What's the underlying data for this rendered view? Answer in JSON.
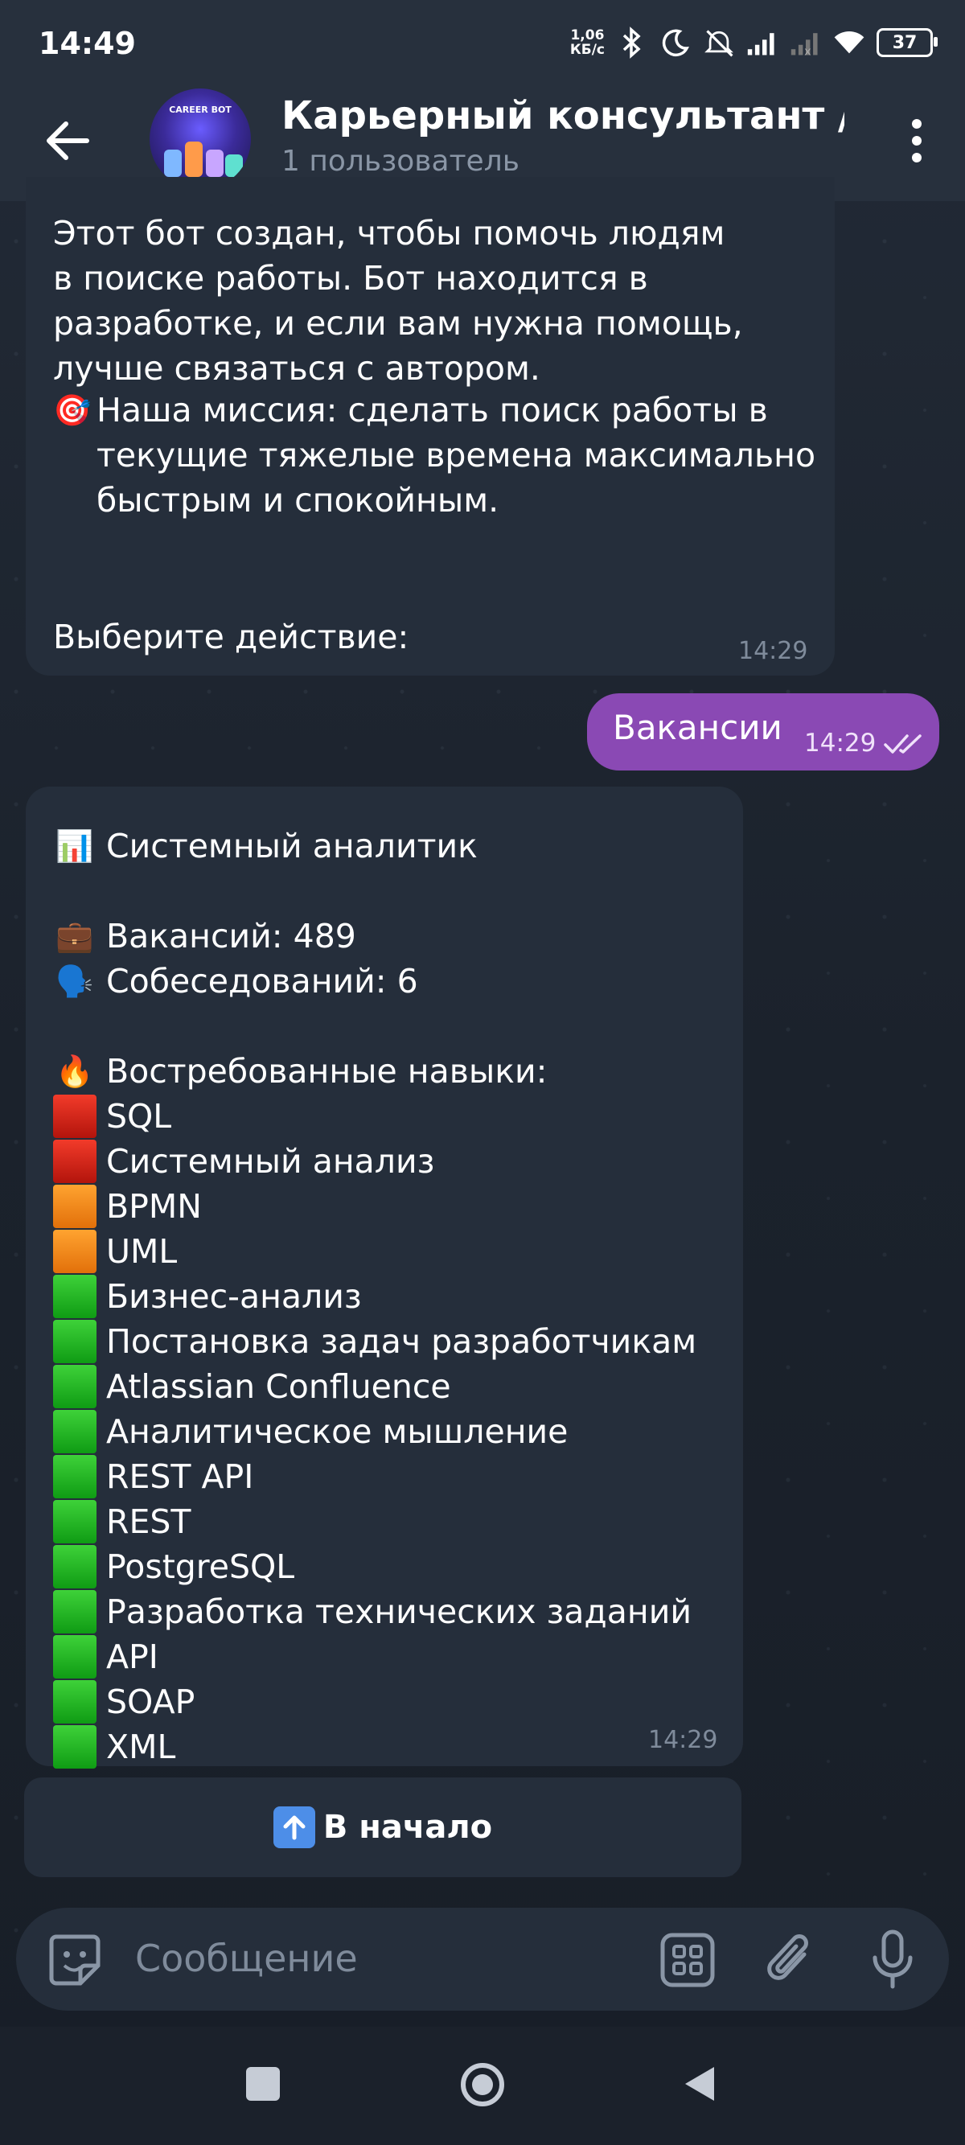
{
  "status_bar": {
    "time": "14:49",
    "net_speed_value": "1,06",
    "net_speed_unit": "КБ/с",
    "battery": "37",
    "icons": [
      "bluetooth-icon",
      "moon-icon",
      "mute-icon",
      "signal-icon",
      "signal-icon",
      "wifi-icon",
      "battery-icon"
    ]
  },
  "header": {
    "title": "Карьерный консультант / ",
    "subtitle": "1 пользователь",
    "avatar_text": "CAREER BOT"
  },
  "messages": {
    "intro": {
      "p1": "Этот бот создан, чтобы помочь людям\nв поиске работы. Бот находится в\nразработке, и если вам нужна помощь,\nлучше связаться с автором.",
      "mission_emoji": "🎯",
      "mission": "Наша миссия: сделать поиск работы в\nтекущие тяжелые времена максимально\nбыстрым и спокойным.",
      "prompt": "Выберите действие:",
      "time": "14:29"
    },
    "outgoing": {
      "text": "Вакансии",
      "time": "14:29"
    },
    "result": {
      "title_emoji": "📊",
      "title": "Системный аналитик",
      "vacancies_emoji": "💼",
      "vacancies": "Вакансий: 489",
      "interviews_emoji": "🗣️",
      "interviews": "Собеседований: 6",
      "skills_emoji": "🔥",
      "skills_header": "Востребованные навыки:",
      "skills": [
        {
          "name": "SQL",
          "level": "red"
        },
        {
          "name": "Системный анализ",
          "level": "red"
        },
        {
          "name": "BPMN",
          "level": "orange"
        },
        {
          "name": "UML",
          "level": "orange"
        },
        {
          "name": "Бизнес-анализ",
          "level": "green"
        },
        {
          "name": "Постановка задач разработчикам",
          "level": "green"
        },
        {
          "name": "Atlassian Confluence",
          "level": "green"
        },
        {
          "name": "Аналитическое мышление",
          "level": "green"
        },
        {
          "name": "REST API",
          "level": "green"
        },
        {
          "name": "REST",
          "level": "green"
        },
        {
          "name": "PostgreSQL",
          "level": "green"
        },
        {
          "name": "Разработка технических заданий",
          "level": "green"
        },
        {
          "name": "API",
          "level": "green"
        },
        {
          "name": "SOAP",
          "level": "green"
        },
        {
          "name": "XML",
          "level": "green"
        }
      ],
      "time": "14:29"
    }
  },
  "keyboard": {
    "home_button_label": "В начало"
  },
  "input": {
    "placeholder": "Сообщение"
  },
  "colors": {
    "outgoing_bubble": "#8a49b4",
    "incoming_bubble": "#252e3b",
    "header": "#27303d"
  }
}
